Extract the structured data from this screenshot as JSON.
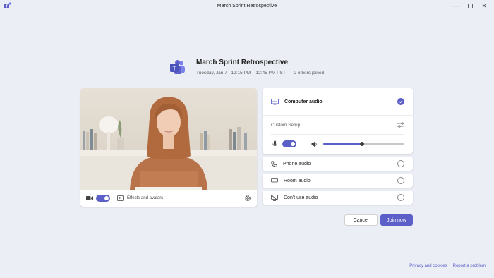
{
  "window": {
    "title": "March Sprint Retrospective",
    "controls": [
      "more-icon",
      "minimize-icon",
      "maximize-icon",
      "close-icon"
    ]
  },
  "meeting": {
    "title": "March Sprint Retrospective",
    "datetime": "Tuesday, Jan 7 · 12:15 PM – 12:45 PM PST",
    "separator": "·",
    "joined": "2 others joined"
  },
  "video": {
    "camera_enabled": true,
    "effects_label": "Effects and avatars"
  },
  "audio": {
    "computer_audio_label": "Computer audio",
    "computer_audio_selected": true,
    "custom_setup_label": "Custom Setup",
    "mic_enabled": true,
    "speaker_volume": 0.48,
    "options": [
      {
        "label": "Phone audio",
        "icon": "phone-icon"
      },
      {
        "label": "Room audio",
        "icon": "room-icon"
      },
      {
        "label": "Don't use audio",
        "icon": "no-audio-icon"
      }
    ]
  },
  "actions": {
    "cancel_label": "Cancel",
    "join_label": "Join now"
  },
  "footer": {
    "privacy_label": "Privacy and cookies",
    "report_label": "Report a problem"
  },
  "colors": {
    "accent": "#5b5fc7",
    "background": "#eceef5"
  }
}
